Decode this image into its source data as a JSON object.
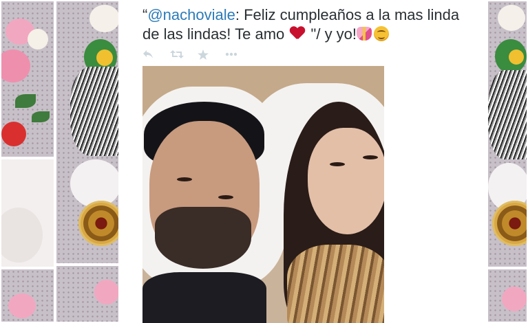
{
  "tweet": {
    "mention": "@nachoviale",
    "text_before_heart": ": Feliz cumpleaños a la mas linda de las lindas! Te amo",
    "text_after_heart": "\"/ y yo!",
    "open_quote": "“"
  },
  "actions": {
    "reply_icon": "reply-icon",
    "retweet_icon": "retweet-icon",
    "favorite_icon": "star-icon",
    "more_icon": "more-icon"
  },
  "photo": {
    "description_icon": "photo"
  },
  "colors": {
    "mention": "#2b7bb9",
    "text": "#292f33",
    "action_icons": "#ccd6dd",
    "heart": "#c8102e"
  }
}
